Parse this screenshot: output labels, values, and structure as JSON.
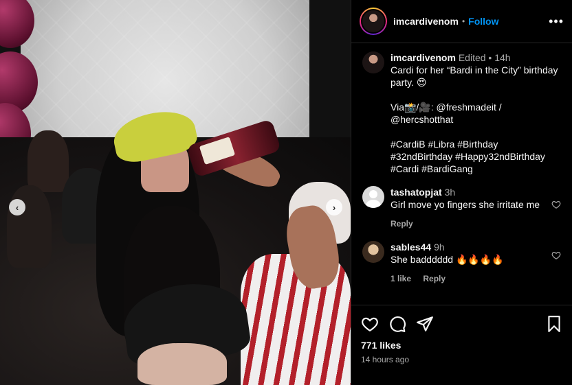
{
  "post": {
    "username": "imcardivenom",
    "follow_label": "Follow",
    "more_label": "•••"
  },
  "caption": {
    "username": "imcardivenom",
    "meta": "Edited  •  14h",
    "text": "Cardi for her “Bardi in the City” birthday party. 😍\n\nVia📸/🎥: @freshmadeit / @hercshotthat\n\n#CardiB #Libra #Birthday #32ndBirthday #Happy32ndBirthday #Cardi #BardiGang"
  },
  "comments": [
    {
      "username": "tashatopjat",
      "time": "3h",
      "text": "Girl move yo fingers she irritate me",
      "actions": [
        "Reply"
      ]
    },
    {
      "username": "sables44",
      "time": "9h",
      "text": "She badddddd 🔥🔥🔥🔥",
      "actions": [
        "1 like",
        "Reply"
      ]
    }
  ],
  "footer": {
    "likes": "771 likes",
    "time": "14 hours ago"
  },
  "nav": {
    "prev": "‹",
    "next": "›"
  },
  "colors": {
    "accent": "#0095f6",
    "bg": "#000000",
    "muted": "#a8a8a8"
  },
  "icons": [
    "heart-icon",
    "comment-icon",
    "share-icon",
    "bookmark-icon",
    "ellipsis-icon",
    "chevron-left-icon",
    "chevron-right-icon"
  ]
}
